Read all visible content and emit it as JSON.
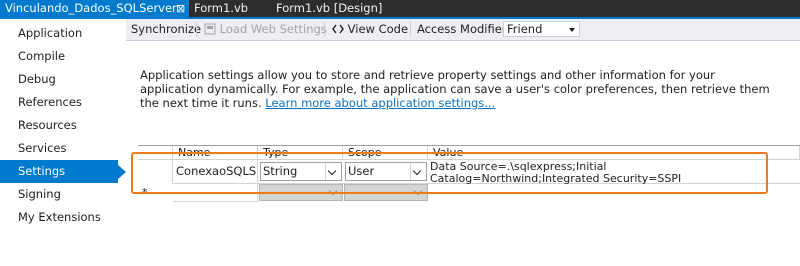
{
  "tabs": [
    {
      "label": "Vinculando_Dados_SQLServer",
      "close": "⊠",
      "active": true
    },
    {
      "label": "Form1.vb",
      "active": false
    },
    {
      "label": "Form1.vb [Design]",
      "active": false
    }
  ],
  "sidebar": {
    "items": [
      {
        "label": "Application"
      },
      {
        "label": "Compile"
      },
      {
        "label": "Debug"
      },
      {
        "label": "References"
      },
      {
        "label": "Resources"
      },
      {
        "label": "Services"
      },
      {
        "label": "Settings",
        "selected": true
      },
      {
        "label": "Signing"
      },
      {
        "label": "My Extensions"
      }
    ]
  },
  "toolbar": {
    "synchronize": "Synchronize",
    "load_web_settings": "Load Web Settings",
    "view_code": "View Code",
    "access_modifier_label": "Access Modifier:",
    "access_modifier_value": "Friend"
  },
  "description": {
    "text": "Application settings allow you to store and retrieve property settings and other information for your application dynamically. For example, the application can save a user's color preferences, then retrieve them the next time it runs.",
    "link": "Learn more about application settings..."
  },
  "grid": {
    "headers": [
      "Name",
      "Type",
      "Scope",
      "Value"
    ],
    "rows": [
      {
        "name": "ConexaoSQLS...",
        "type": "String",
        "scope": "User",
        "value": "Data Source=.\\sqlexpress;Initial Catalog=Northwind;Integrated Security=SSPI"
      }
    ],
    "new_row_marker": "*"
  },
  "colors": {
    "accent": "#007acc",
    "highlight": "#f07a1a",
    "tab_bar": "#2d2d30"
  }
}
